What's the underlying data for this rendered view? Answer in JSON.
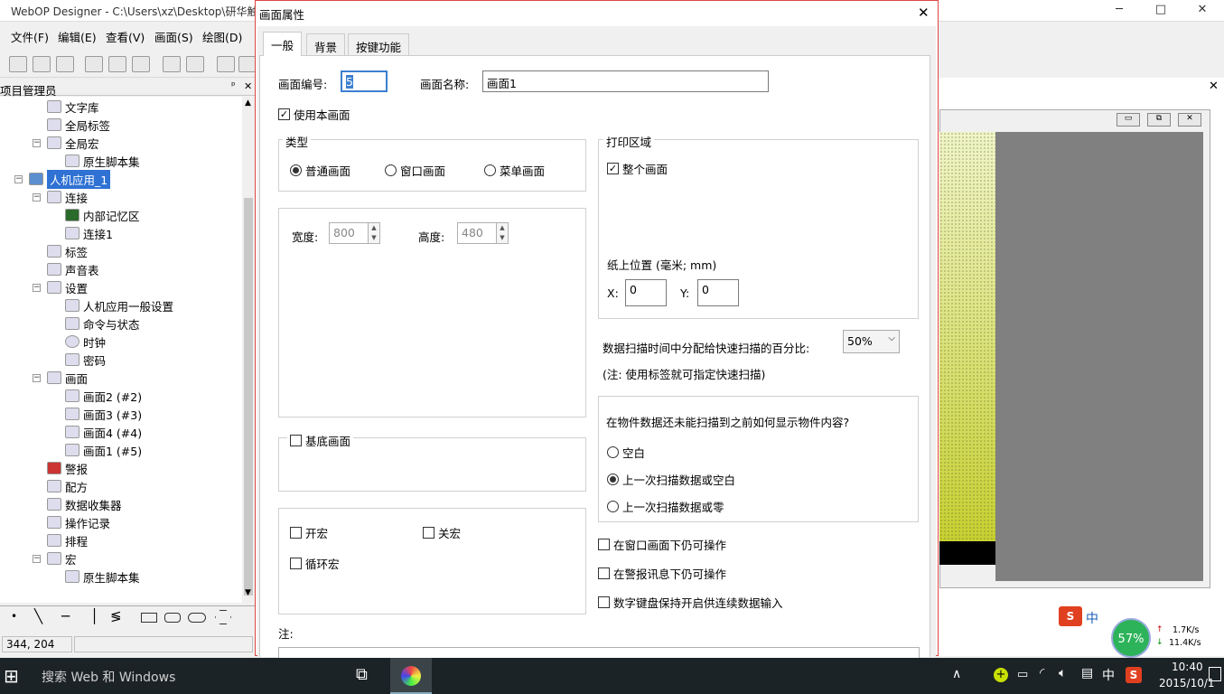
{
  "app": {
    "title": "WebOP Designer - C:\\Users\\xz\\Desktop\\研华触",
    "min": "─",
    "max": "□",
    "close": "✕"
  },
  "menu": [
    "文件(F)",
    "编辑(E)",
    "查看(V)",
    "画面(S)",
    "绘图(D)"
  ],
  "project": {
    "header": "项目管理员",
    "pin": "ᵖ",
    "close": "✕",
    "items": [
      "文字库",
      "全局标签",
      "全局宏",
      "原生脚本集",
      "人机应用_1",
      "连接",
      "内部记忆区",
      "连接1",
      "标签",
      "声音表",
      "设置",
      "人机应用一般设置",
      "命令与状态",
      "时钟",
      "密码",
      "画面",
      "画面2 (#2)",
      "画面3 (#3)",
      "画面4 (#4)",
      "画面1 (#5)",
      "警报",
      "配方",
      "数据收集器",
      "操作记录",
      "排程",
      "宏",
      "原生脚本集"
    ]
  },
  "status": {
    "coords": "344, 204"
  },
  "dialog": {
    "title": "画面属性",
    "close": "✕",
    "tabs": [
      "一般",
      "背景",
      "按键功能"
    ],
    "screen_no_label": "画面编号:",
    "screen_no": "5",
    "screen_name_label": "画面名称:",
    "screen_name": "画面1",
    "use_screen": "使用本画面",
    "type": {
      "title": "类型",
      "options": [
        "普通画面",
        "窗口画面",
        "菜单画面"
      ],
      "selected": 0
    },
    "size": {
      "width_label": "宽度:",
      "width": "800",
      "height_label": "高度:",
      "height": "480"
    },
    "base_screen": "基底画面",
    "macros": {
      "open": "开宏",
      "close": "关宏",
      "loop": "循环宏"
    },
    "note": "注:",
    "print": {
      "title": "打印区域",
      "whole": "整个画面",
      "pos_label": "纸上位置 (毫米; mm)",
      "x_label": "X:",
      "x": "0",
      "y_label": "Y:",
      "y": "0"
    },
    "scan": {
      "label": "数据扫描时间中分配给快速扫描的百分比:",
      "value": "50%",
      "note": "(注: 使用标签就可指定快速扫描)"
    },
    "display": {
      "question": "在物件数据还未能扫描到之前如何显示物件内容?",
      "options": [
        "空白",
        "上一次扫描数据或空白",
        "上一次扫描数据或零"
      ],
      "selected": 1
    },
    "checks": [
      "在窗口画面下仍可操作",
      "在警报讯息下仍可操作",
      "数字键盘保持开启供连续数据输入"
    ]
  },
  "taskbar": {
    "search": "搜索 Web 和 Windows",
    "ime": "中",
    "time": "10:40",
    "date": "2015/10/1"
  },
  "net": {
    "percent": "57%",
    "up": "1.7K/s",
    "down": "11.4K/s",
    "ime": "中"
  }
}
